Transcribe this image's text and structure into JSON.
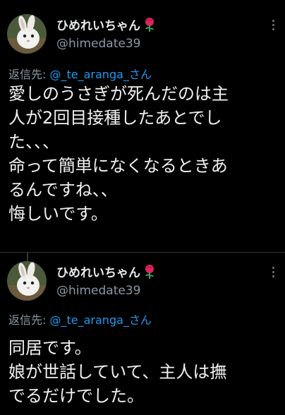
{
  "colors": {
    "background": "#000000",
    "text": "#e7e9ea",
    "secondary": "#8b98a5",
    "link": "#1d9bf0",
    "divider": "#2f3336"
  },
  "tweets": [
    {
      "display_name": "ひめれいちゃん",
      "name_emoji_icon": "rose-icon",
      "handle": "@himedate39",
      "reply_label": "返信先:",
      "reply_mention": "@_te_aranga_さん",
      "more_icon": "more-options-icon",
      "lines": [
        "愛しのうさぎが死んだのは主",
        "人が2回目接種したあとでし",
        "た、、、",
        "命って簡単になくなるときあ",
        "るんですね、、",
        "悔しいです。"
      ]
    },
    {
      "display_name": "ひめれいちゃん",
      "name_emoji_icon": "rose-icon",
      "handle": "@himedate39",
      "reply_label": "返信先:",
      "reply_mention": "@_te_aranga_さん",
      "more_icon": "more-options-icon",
      "lines": [
        "同居です。",
        "娘が世話していて、主人は撫",
        "でるだけでした。"
      ]
    }
  ]
}
